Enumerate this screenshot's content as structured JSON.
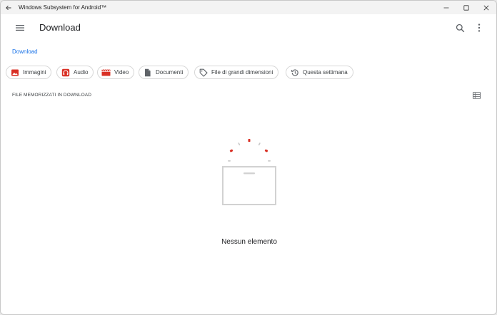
{
  "window": {
    "title": "Windows Subsystem for Android™"
  },
  "appbar": {
    "title": "Download",
    "menu_icon": "hamburger-menu-icon",
    "search_icon": "search-icon",
    "more_icon": "more-vert-icon"
  },
  "breadcrumb": {
    "label": "Download"
  },
  "chips": [
    {
      "label": "Immagini",
      "icon": "image-icon",
      "color": "#d93025"
    },
    {
      "label": "Audio",
      "icon": "headphones-icon",
      "color": "#d93025"
    },
    {
      "label": "Video",
      "icon": "movie-icon",
      "color": "#d93025"
    },
    {
      "label": "Documenti",
      "icon": "document-icon",
      "color": "#5f6368"
    },
    {
      "label": "File di grandi dimensioni",
      "icon": "tag-icon",
      "color": "#5f6368"
    },
    {
      "label": "Questa settimana",
      "icon": "history-icon",
      "color": "#5f6368"
    }
  ],
  "section": {
    "header": "FILE MEMORIZZATI IN DOWNLOAD"
  },
  "empty_state": {
    "text": "Nessun elemento"
  },
  "colors": {
    "accent": "#1a73e8",
    "icon_red": "#d93025",
    "icon_grey": "#5f6368"
  }
}
